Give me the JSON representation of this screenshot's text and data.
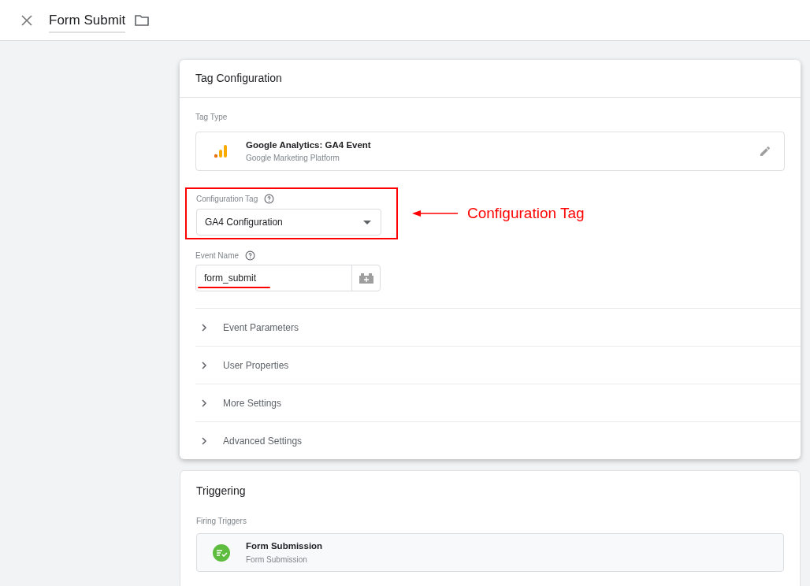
{
  "header": {
    "title": "Form Submit"
  },
  "tag_configuration": {
    "title": "Tag Configuration",
    "tag_type_label": "Tag Type",
    "tag_type": {
      "name": "Google Analytics: GA4 Event",
      "vendor": "Google Marketing Platform"
    },
    "configuration_tag": {
      "label": "Configuration Tag",
      "value": "GA4 Configuration"
    },
    "event_name": {
      "label": "Event Name",
      "value": "form_submit"
    },
    "sections": [
      {
        "label": "Event Parameters",
        "expanded": false
      },
      {
        "label": "User Properties",
        "expanded": false
      },
      {
        "label": "More Settings",
        "expanded": false
      },
      {
        "label": "Advanced Settings",
        "expanded": false
      }
    ]
  },
  "annotation": {
    "label": "Configuration Tag"
  },
  "triggering": {
    "title": "Triggering",
    "label": "Firing Triggers",
    "triggers": [
      {
        "name": "Form Submission",
        "type": "Form Submission"
      }
    ]
  }
}
